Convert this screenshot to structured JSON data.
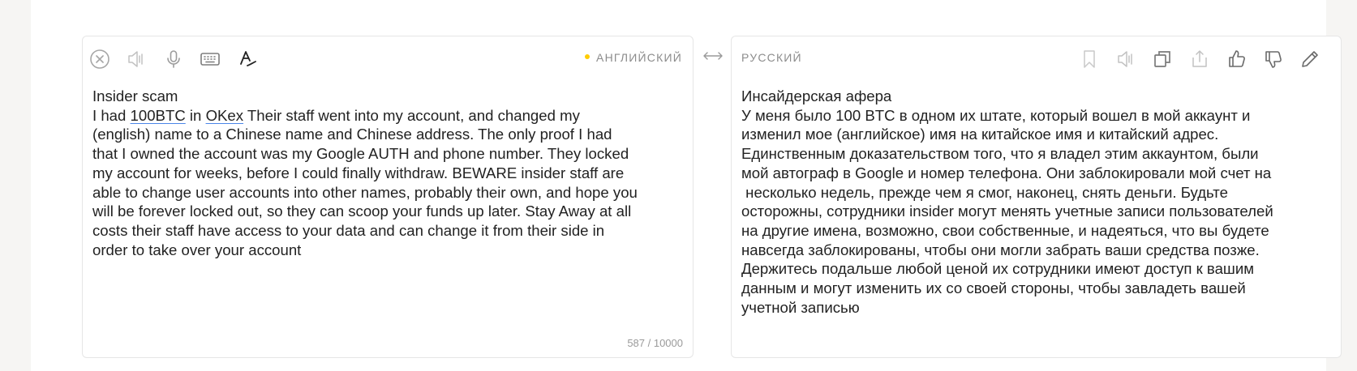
{
  "source": {
    "language": "АНГЛИЙСКИЙ",
    "text_line1": "Insider scam",
    "text_line2_a": "I had ",
    "text_line2_link1": "100BTC",
    "text_line2_b": " in ",
    "text_line2_link2": "OKex",
    "text_rest": " Their staff went into my account, and changed my\n(english) name to a Chinese name and Chinese address. The only proof I had\nthat I owned the account was my Google AUTH and phone number. They locked\nmy account for weeks, before I could finally withdraw. BEWARE insider staff are\nable to change user accounts into other names, probably their own, and hope you\nwill be forever locked out, so they can scoop your funds up later. Stay Away at all\ncosts their staff have access to your data and can change it from their side in\norder to take over your account",
    "counter": "587 / 10000",
    "icons": [
      "clear-icon",
      "speaker-icon",
      "microphone-icon",
      "keyboard-icon",
      "spellcheck-icon"
    ]
  },
  "target": {
    "language": "РУССКИЙ",
    "text": "Инсайдерская афера\nУ меня было 100 BTC в одном их штате, который вошел в мой аккаунт и\nизменил мое (английское) имя на китайское имя и китайский адрес.\nЕдинственным доказательством того, что я владел этим аккаунтом, были\nмой автограф в Google и номер телефона. Они заблокировали мой счет на\n несколько недель, прежде чем я смог, наконец, снять деньги. Будьте\nосторожны, сотрудники insider могут менять учетные записи пользователей\nна другие имена, возможно, свои собственные, и надеяться, что вы будете\nнавсегда заблокированы, чтобы они могли забрать ваши средства позже.\nДержитесь подальше любой ценой их сотрудники имеют доступ к вашим\nданным и могут изменить их со своей стороны, чтобы завладеть вашей\nучетной записью",
    "icons": [
      "bookmark-icon",
      "speaker-icon",
      "copy-icon",
      "share-icon",
      "thumbs-up-icon",
      "thumbs-down-icon",
      "edit-pencil-icon"
    ]
  },
  "swap_icon": "swap-arrows-icon",
  "colors": {
    "background": "#f6f5f3",
    "panel": "#ffffff",
    "border": "#e6e6e6",
    "icon_gray": "#b3b3b3",
    "icon_dark": "#333333",
    "accent_dot": "#ffcc00",
    "link_underline": "#4a86e8"
  }
}
